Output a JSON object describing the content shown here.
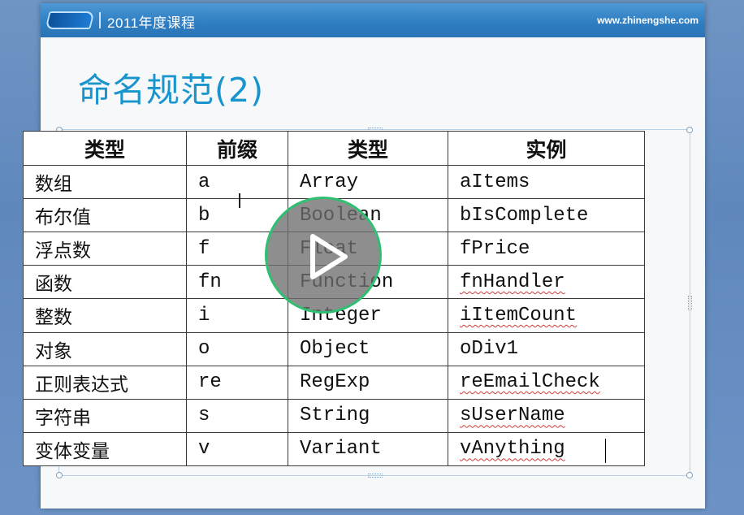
{
  "header": {
    "course_title": "2011年度课程",
    "site_url": "www.zhinengshe.com"
  },
  "slide": {
    "title": "命名规范(2)"
  },
  "table": {
    "headers": [
      "类型",
      "前缀",
      "类型",
      "实例"
    ],
    "rows": [
      [
        "数组",
        "a",
        "Array",
        "aItems"
      ],
      [
        "布尔值",
        "b",
        "Boolean",
        "bIsComplete"
      ],
      [
        "浮点数",
        "f",
        "Float",
        "fPrice"
      ],
      [
        "函数",
        "fn",
        "Function",
        "fnHandler"
      ],
      [
        "整数",
        "i",
        "Integer",
        "iItemCount"
      ],
      [
        "对象",
        "o",
        "Object",
        "oDiv1"
      ],
      [
        "正则表达式",
        "re",
        "RegExp",
        "reEmailCheck"
      ],
      [
        "字符串",
        "s",
        "String",
        "sUserName"
      ],
      [
        "变体变量",
        "v",
        "Variant",
        "vAnything"
      ]
    ]
  },
  "icons": {
    "play": "play-icon",
    "logo": "brand-logo-icon"
  },
  "colors": {
    "title": "#1994cc",
    "play_ring": "#2fbf71",
    "header_bar": "#2f7fc3"
  }
}
